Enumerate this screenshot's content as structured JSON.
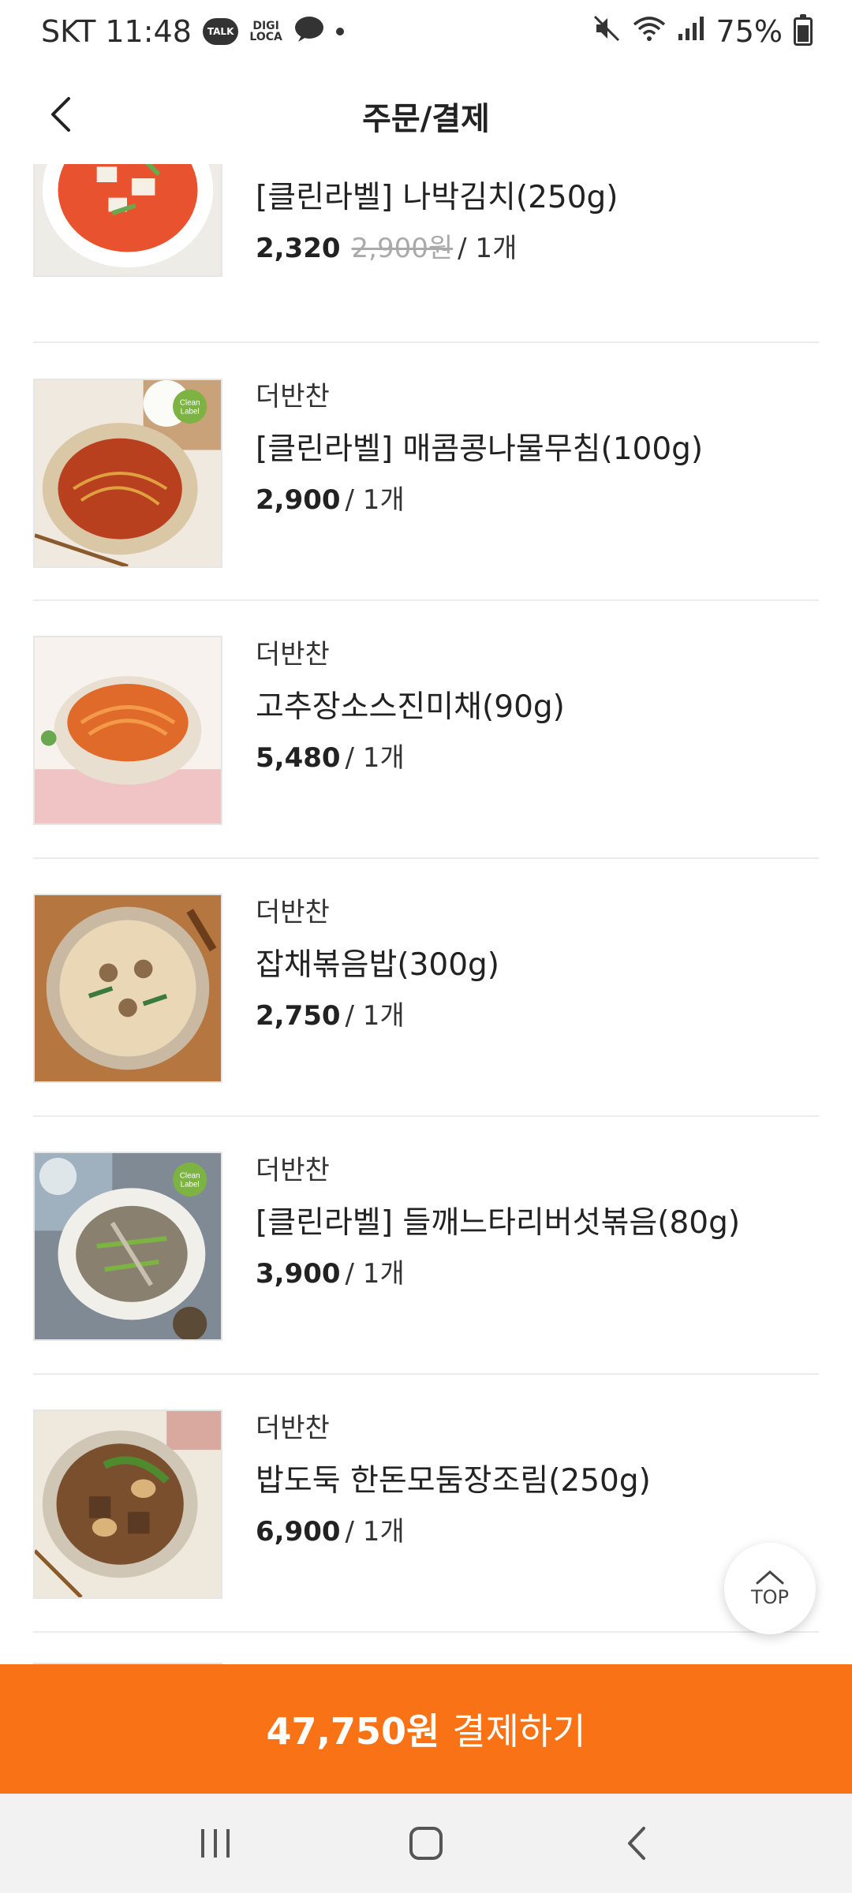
{
  "status_bar": {
    "carrier_time": "SKT 11:48",
    "talk_badge": "TALK",
    "digi_line1": "DIGI",
    "digi_line2": "LOCA",
    "battery": "75%"
  },
  "header": {
    "title": "주문/결제",
    "back_icon": "chevron-left-icon"
  },
  "items": [
    {
      "brand": "",
      "name": "[클린라벨] 나박김치(250g)",
      "price": "2,320",
      "original_price": "2,900원",
      "qty": "/ 1개"
    },
    {
      "brand": "더반찬",
      "name": "[클린라벨] 매콤콩나물무침(100g)",
      "price": "2,900",
      "original_price": "",
      "qty": "/ 1개",
      "badge": "Clean Label"
    },
    {
      "brand": "더반찬",
      "name": "고추장소스진미채(90g)",
      "price": "5,480",
      "original_price": "",
      "qty": "/ 1개"
    },
    {
      "brand": "더반찬",
      "name": "잡채볶음밥(300g)",
      "price": "2,750",
      "original_price": "",
      "qty": "/ 1개"
    },
    {
      "brand": "더반찬",
      "name": "[클린라벨] 들깨느타리버섯볶음(80g)",
      "price": "3,900",
      "original_price": "",
      "qty": "/ 1개",
      "badge": "Clean Label"
    },
    {
      "brand": "더반찬",
      "name": "밥도둑 한돈모둠장조림(250g)",
      "price": "6,900",
      "original_price": "",
      "qty": "/ 1개"
    }
  ],
  "top_button": {
    "label": "TOP"
  },
  "pay_bar": {
    "amount": "47,750원",
    "label": "결제하기"
  },
  "colors": {
    "accent": "#f97316",
    "clean_label": "#7cb342"
  }
}
